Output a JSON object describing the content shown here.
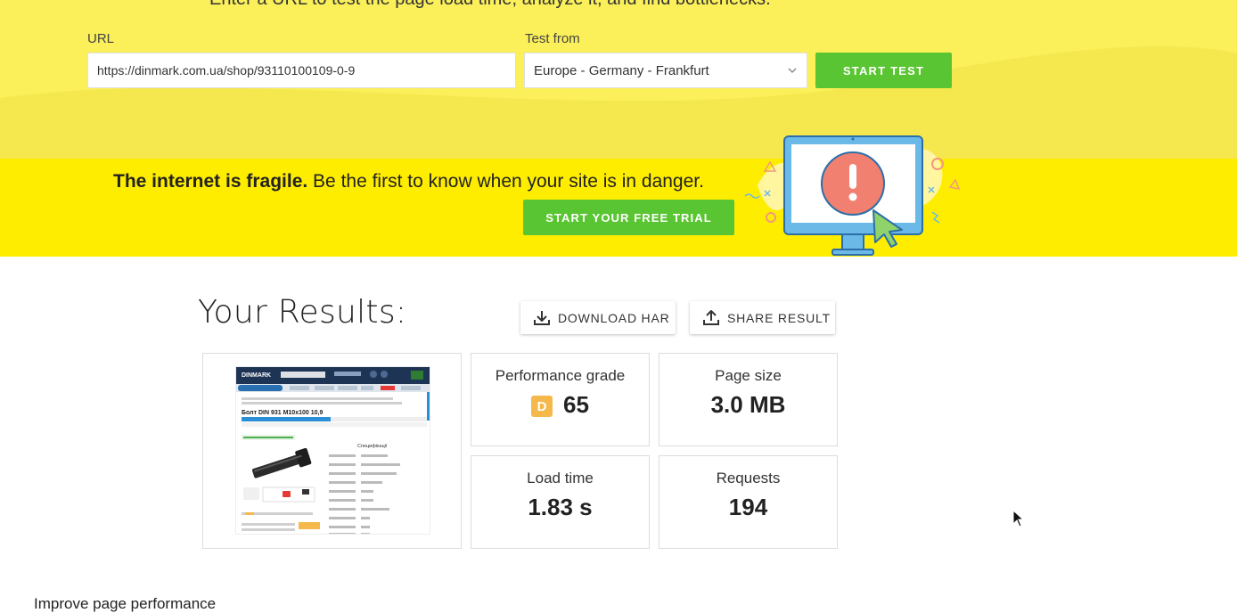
{
  "hero": {
    "tagline": "Enter a URL to test the page load time, analyze it, and find bottlenecks.",
    "url_label": "URL",
    "url_value": "https://dinmark.com.ua/shop/93110100109-0-9",
    "location_label": "Test from",
    "location_value": "Europe - Germany - Frankfurt",
    "start_label": "START TEST"
  },
  "promo": {
    "bold": "The internet is fragile.",
    "text": " Be the first to know when your site is in danger.",
    "trial_label": "START YOUR FREE TRIAL"
  },
  "results": {
    "title": "Your Results:",
    "download_label": "DOWNLOAD HAR",
    "share_label": "SHARE RESULT",
    "grade_label": "Performance grade",
    "grade_letter": "D",
    "grade_value": "65",
    "size_label": "Page size",
    "size_value": "3.0 MB",
    "load_label": "Load time",
    "load_value": "1.83 s",
    "requests_label": "Requests",
    "requests_value": "194"
  },
  "screenshot_preview": {
    "logo": "DINMARK",
    "product_title": "Болт DIN 931 M10x100 10,9",
    "spec_heading": "Специфікації"
  },
  "improve": {
    "label": "Improve page performance"
  },
  "colors": {
    "hero_bg": "#fbef5a",
    "promo_bg": "#ffed00",
    "green": "#5ac532",
    "grade_badge": "#f4b94a"
  }
}
